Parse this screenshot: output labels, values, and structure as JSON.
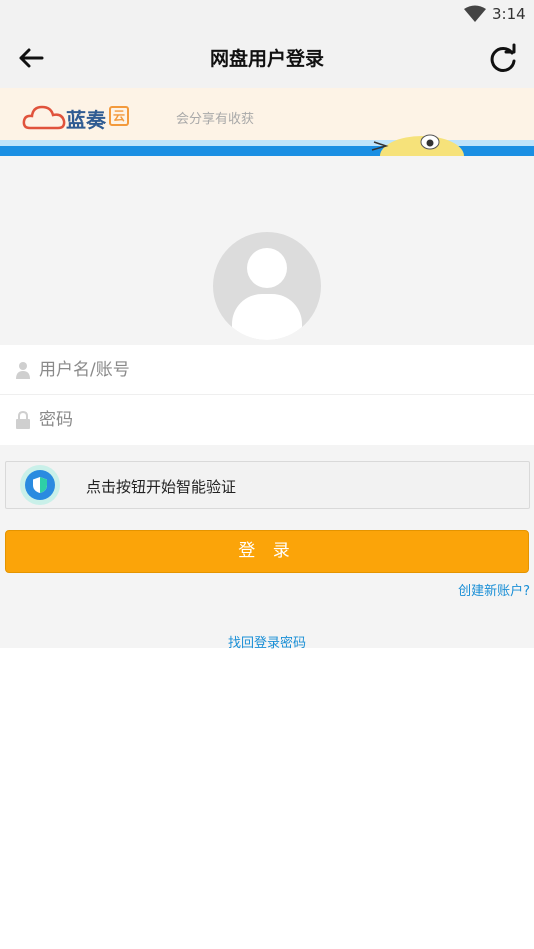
{
  "status_bar": {
    "time": "3:14",
    "wifi_icon": "wifi-icon"
  },
  "app_bar": {
    "title": "网盘用户登录",
    "back_icon": "arrow-left-icon",
    "refresh_icon": "refresh-icon"
  },
  "banner": {
    "logo_text": "蓝奏",
    "logo_badge": "云",
    "slogan": "会分享有收获",
    "colors": {
      "stripe": "#1a8fe3",
      "logo_cloud": "#e0533c",
      "logo_text": "#2f5b92"
    }
  },
  "form": {
    "username": {
      "placeholder": "用户名/账号",
      "value": "",
      "icon": "person-icon"
    },
    "password": {
      "placeholder": "密码",
      "value": "",
      "icon": "lock-icon"
    }
  },
  "verify": {
    "label": "点击按钮开始智能验证",
    "icon": "shield-icon"
  },
  "login_button": {
    "label": "登 录",
    "color": "#fba409"
  },
  "links": {
    "create_account": "创建新账户?",
    "recover_password": "找回登录密码"
  }
}
